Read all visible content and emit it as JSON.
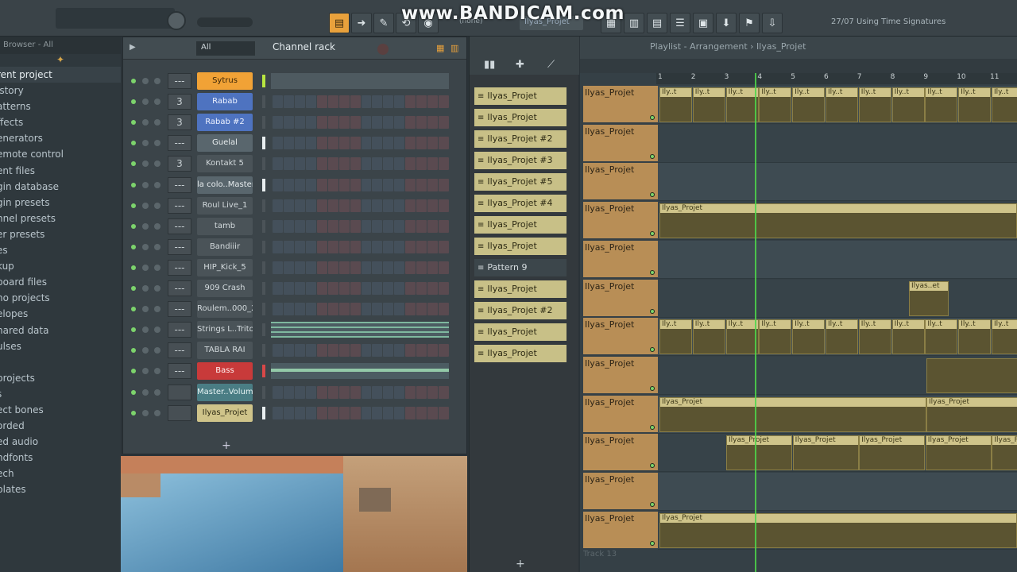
{
  "toolbar": {
    "watermark": "www.BANDICAM.com",
    "pattern_selector": "(none)",
    "pattern_name": "Ilyas_Projet",
    "hint": "27/07 Using Time Signatures",
    "tools_left": [
      "pattern-icon",
      "arrow-icon",
      "draw-icon",
      "snap-icon",
      "record-icon"
    ],
    "tools_right": [
      "playlist-icon",
      "piano-roll-icon",
      "channel-rack-icon",
      "mixer-icon",
      "plugin-icon",
      "browser-icon",
      "tempo-icon",
      "export-icon"
    ]
  },
  "browser": {
    "header": "Browser - All",
    "items": [
      "rent project",
      "istory",
      "atterns",
      "ffects",
      "enerators",
      "emote control",
      "ent files",
      "gin database",
      "gin presets",
      "nnel presets",
      "er presets",
      "es",
      "kup",
      "board files",
      "no projects",
      "elopes",
      "hared data",
      "ulses",
      "",
      "projects",
      "s",
      "ect bones",
      "orded",
      "ed audio",
      "ndfonts",
      "ech",
      "plates"
    ]
  },
  "rack": {
    "filter": "All",
    "title": "Channel rack",
    "channels": [
      {
        "name": "Sytrus",
        "mix": "---",
        "color": "#f1a236",
        "text": "#3a2508"
      },
      {
        "name": "Rabab",
        "mix": "3",
        "color": "#4e73c0",
        "text": "#ecf1ff"
      },
      {
        "name": "Rabab #2",
        "mix": "3",
        "color": "#4e73c0",
        "text": "#ecf1ff"
      },
      {
        "name": "Guelal",
        "mix": "---",
        "color": "#59666d",
        "text": "#e7ecee"
      },
      {
        "name": "Kontakt 5",
        "mix": "3",
        "color": "#4a5358",
        "text": "#d3dadd"
      },
      {
        "name": "la colo..Master)",
        "mix": "---",
        "color": "#59666d",
        "text": "#e7ecee"
      },
      {
        "name": "Roul Live_1",
        "mix": "---",
        "color": "#4a5358",
        "text": "#d3dadd"
      },
      {
        "name": "tamb",
        "mix": "---",
        "color": "#4a5358",
        "text": "#d3dadd"
      },
      {
        "name": "Bandiiir",
        "mix": "---",
        "color": "#4a5358",
        "text": "#d3dadd"
      },
      {
        "name": "HIP_Kick_5",
        "mix": "---",
        "color": "#4a5358",
        "text": "#d3dadd"
      },
      {
        "name": "909 Crash",
        "mix": "---",
        "color": "#4a5358",
        "text": "#d3dadd"
      },
      {
        "name": "Roulem..000_2",
        "mix": "---",
        "color": "#4a5358",
        "text": "#d3dadd"
      },
      {
        "name": "Strings L..Triton",
        "mix": "---",
        "color": "#4a5358",
        "text": "#d3dadd"
      },
      {
        "name": "TABLA RAI",
        "mix": "---",
        "color": "#4a5358",
        "text": "#d3dadd"
      },
      {
        "name": "Bass",
        "mix": "---",
        "color": "#c83a3a",
        "text": "#fff0f0"
      },
      {
        "name": "Master..Volume",
        "mix": "",
        "color": "#4a7d84",
        "text": "#e6f3f4"
      },
      {
        "name": "Ilyas_Projet",
        "mix": "",
        "color": "#cfc48a",
        "text": "#2d2a14"
      }
    ]
  },
  "picker": {
    "items": [
      {
        "label": "Ilyas_Projet",
        "dark": false
      },
      {
        "label": "Ilyas_Projet",
        "dark": false
      },
      {
        "label": "Ilyas_Projet #2",
        "dark": false
      },
      {
        "label": "Ilyas_Projet #3",
        "dark": false
      },
      {
        "label": "Ilyas_Projet #5",
        "dark": false
      },
      {
        "label": "Ilyas_Projet #4",
        "dark": false
      },
      {
        "label": "Ilyas_Projet",
        "dark": false
      },
      {
        "label": "Ilyas_Projet",
        "dark": false
      },
      {
        "label": "Pattern 9",
        "dark": true
      },
      {
        "label": "Ilyas_Projet",
        "dark": false
      },
      {
        "label": "Ilyas_Projet #2",
        "dark": false
      },
      {
        "label": "Ilyas_Projet",
        "dark": false
      },
      {
        "label": "Ilyas_Projet",
        "dark": false
      }
    ]
  },
  "playlist": {
    "title": "Playlist - Arrangement › Ilyas_Projet",
    "bars": [
      "1",
      "2",
      "3",
      "4",
      "5",
      "6",
      "7",
      "8",
      "9",
      "10",
      "11"
    ],
    "tracks": [
      "Ilyas_Projet",
      "Ilyas_Projet",
      "Ilyas_Projet",
      "Ilyas_Projet",
      "Ilyas_Projet",
      "Ilyas_Projet",
      "Ilyas_Projet",
      "Ilyas_Projet",
      "Ilyas_Projet",
      "Ilyas_Projet",
      "Ilyas_Projet",
      "Ilyas_Projet"
    ],
    "empty_track": "Track 13",
    "clip_labels": {
      "short": "Ily..t",
      "full": "Ilyas_Projet",
      "mid": "Ilyas..et"
    }
  }
}
